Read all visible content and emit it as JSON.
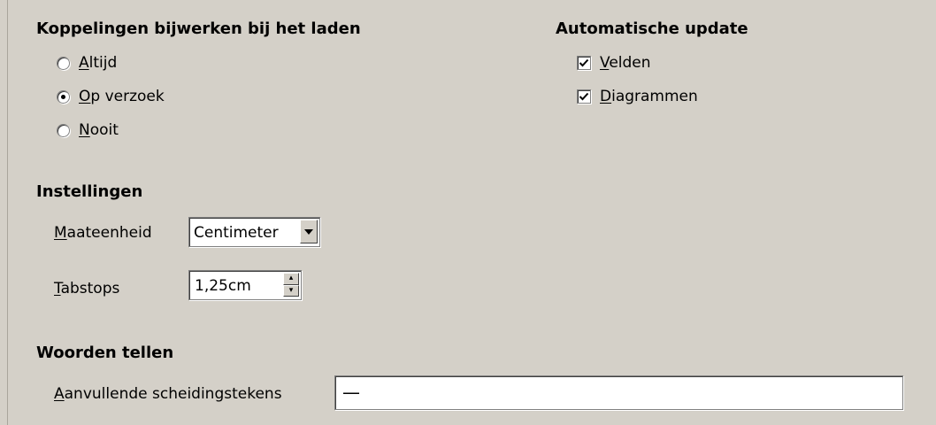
{
  "links": {
    "heading": "Koppelingen bijwerken bij het laden",
    "options": [
      {
        "key": "A",
        "rest": "ltijd",
        "selected": false
      },
      {
        "key": "O",
        "rest": "p verzoek",
        "selected": true
      },
      {
        "key": "N",
        "rest": "ooit",
        "selected": false
      }
    ]
  },
  "auto_update": {
    "heading": "Automatische update",
    "items": [
      {
        "key": "V",
        "rest": "elden",
        "checked": true
      },
      {
        "key": "D",
        "rest": "iagrammen",
        "checked": true
      }
    ]
  },
  "settings": {
    "heading": "Instellingen",
    "unit": {
      "key": "M",
      "rest": "aateenheid",
      "value": "Centimeter"
    },
    "tabstops": {
      "key": "T",
      "rest": "abstops",
      "value": "1,25cm"
    }
  },
  "wordcount": {
    "heading": "Woorden tellen",
    "separators": {
      "key": "A",
      "rest": "anvullende scheidingstekens",
      "value": "—"
    }
  }
}
